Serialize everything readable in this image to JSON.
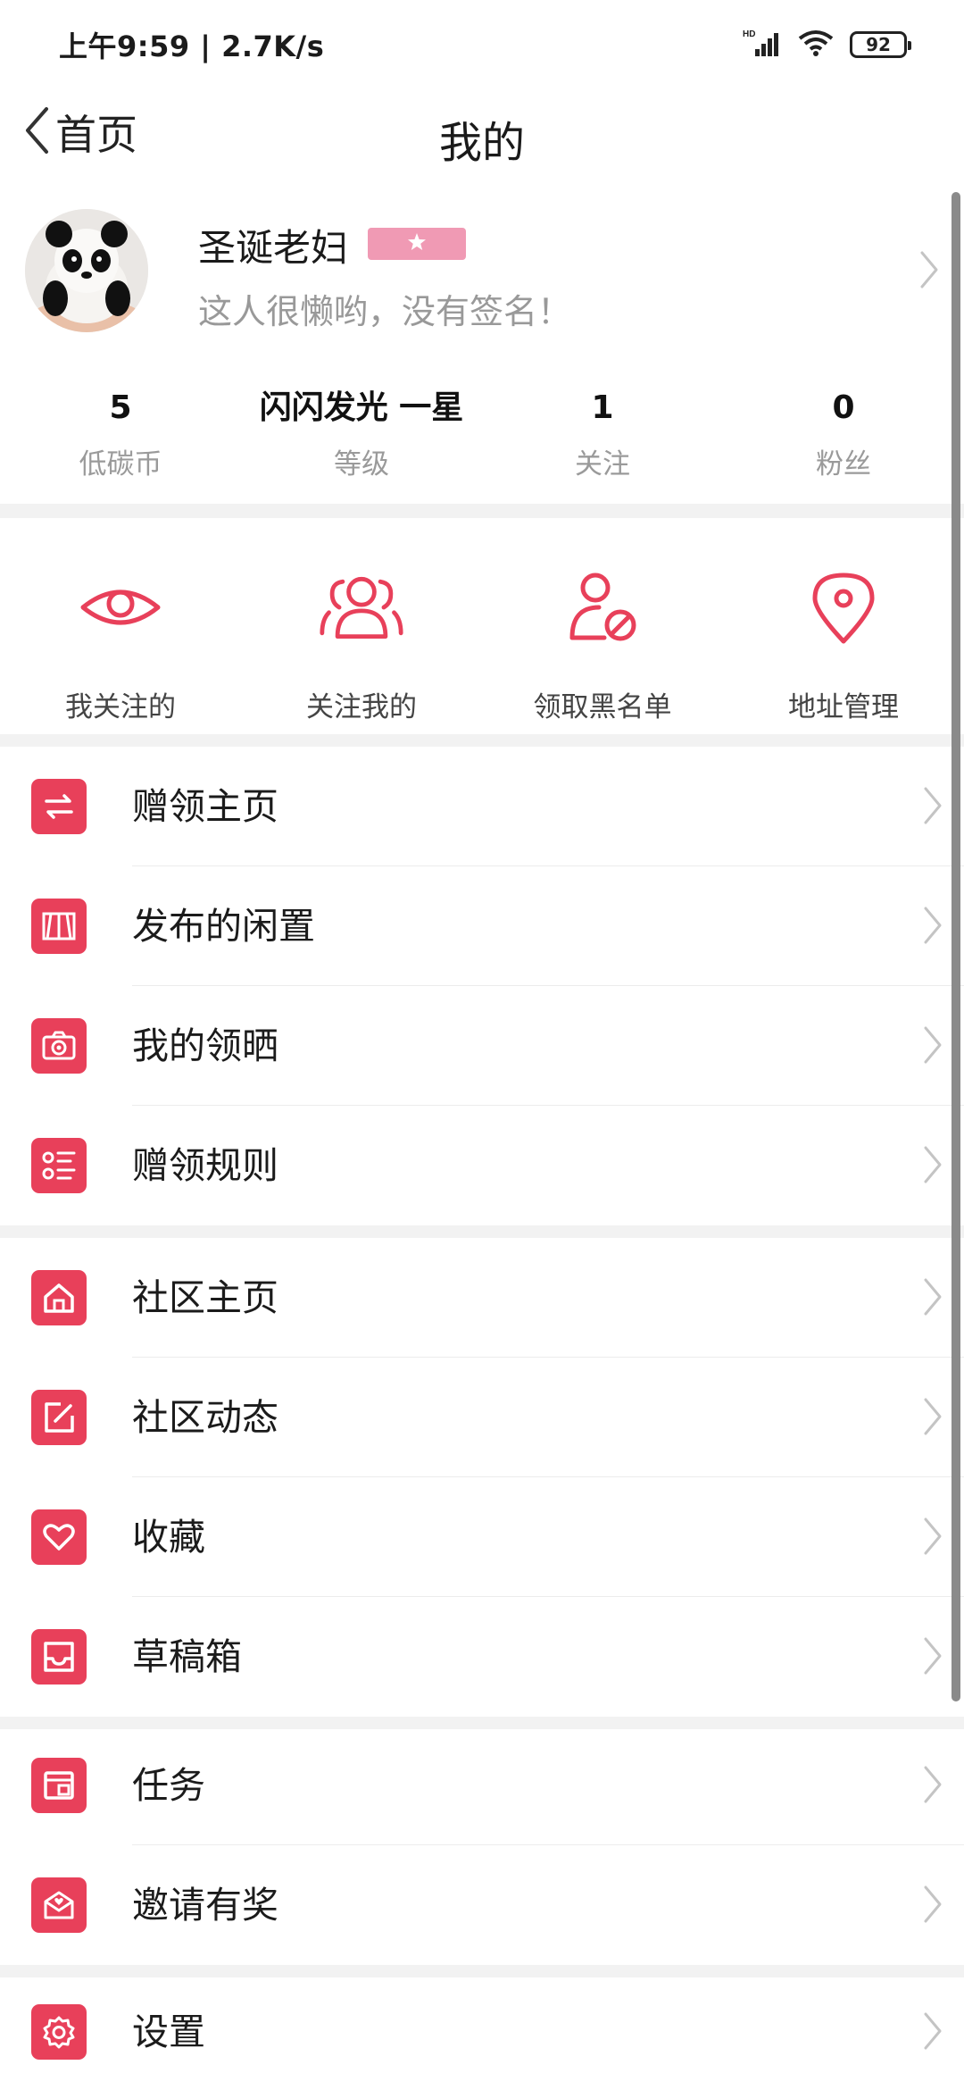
{
  "status_bar": {
    "time": "上午9:59 | 2.7K/s",
    "network": "HD",
    "battery": "92"
  },
  "nav": {
    "back_label": "首页",
    "title": "我的"
  },
  "profile": {
    "name": "圣诞老妇",
    "signature": "这人很懒哟，没有签名！",
    "badge_color": "#f09ab4"
  },
  "stats": [
    {
      "value": "5",
      "label": "低碳币"
    },
    {
      "value": "闪闪发光 一星",
      "label": "等级"
    },
    {
      "value": "1",
      "label": "关注"
    },
    {
      "value": "0",
      "label": "粉丝"
    }
  ],
  "quick_actions": [
    {
      "label": "我关注的",
      "icon": "eye-icon"
    },
    {
      "label": "关注我的",
      "icon": "users-icon"
    },
    {
      "label": "领取黑名单",
      "icon": "user-block-icon"
    },
    {
      "label": "地址管理",
      "icon": "location-pin-icon"
    }
  ],
  "menu_group_1": [
    {
      "label": "赠领主页",
      "icon": "exchange-icon"
    },
    {
      "label": "发布的闲置",
      "icon": "stall-icon"
    },
    {
      "label": "我的领晒",
      "icon": "camera-icon"
    },
    {
      "label": "赠领规则",
      "icon": "list-icon"
    }
  ],
  "menu_group_2": [
    {
      "label": "社区主页",
      "icon": "home-icon"
    },
    {
      "label": "社区动态",
      "icon": "edit-icon"
    },
    {
      "label": "收藏",
      "icon": "heart-icon"
    },
    {
      "label": "草稿箱",
      "icon": "inbox-icon"
    }
  ],
  "menu_group_3": [
    {
      "label": "任务",
      "icon": "task-icon"
    },
    {
      "label": "邀请有奖",
      "icon": "invite-icon"
    }
  ],
  "menu_group_4": [
    {
      "label": "设置",
      "icon": "gear-icon"
    }
  ],
  "colors": {
    "accent": "#e8405a",
    "divider": "#ececec",
    "section_gap": "#f2f2f2"
  }
}
